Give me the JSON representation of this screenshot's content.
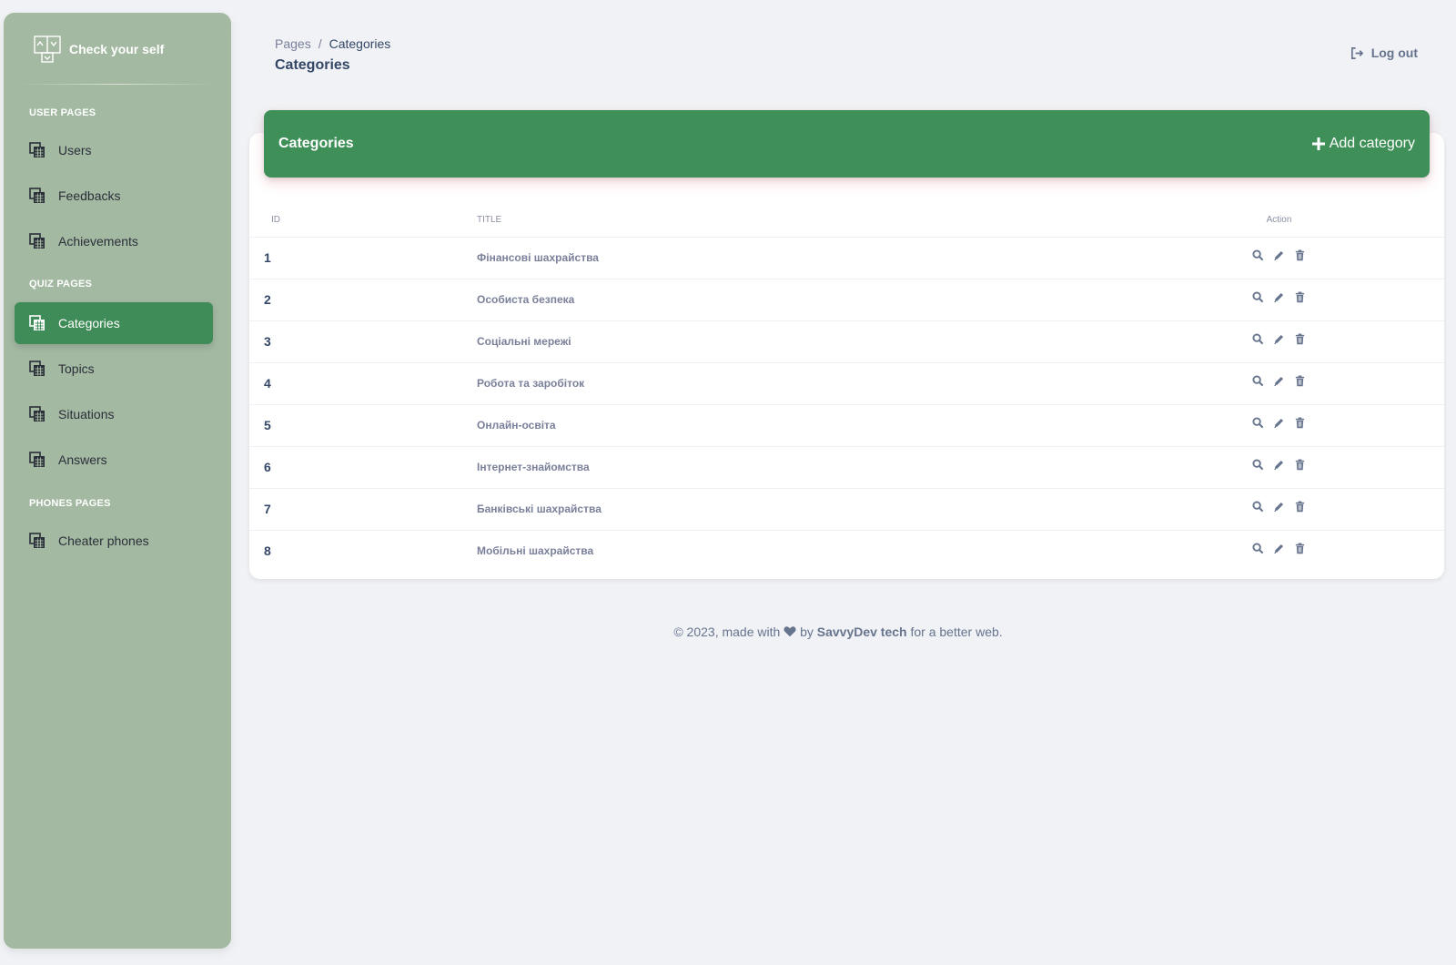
{
  "sidebar": {
    "brand": "Check your self",
    "sections": [
      {
        "title": "USER PAGES"
      },
      {
        "title": "QUIZ PAGES"
      },
      {
        "title": "PHONES PAGES"
      }
    ],
    "items": [
      {
        "label": "Users"
      },
      {
        "label": "Feedbacks"
      },
      {
        "label": "Achievements"
      },
      {
        "label": "Categories",
        "active": true
      },
      {
        "label": "Topics"
      },
      {
        "label": "Situations"
      },
      {
        "label": "Answers"
      },
      {
        "label": "Cheater phones"
      }
    ]
  },
  "header": {
    "breadcrumb": {
      "root": "Pages",
      "separator": "/",
      "current": "Categories"
    },
    "title": "Categories",
    "logout": "Log out"
  },
  "card": {
    "title": "Categories",
    "add_label": "Add category",
    "columns": [
      "ID",
      "TITLE",
      "Action"
    ],
    "rows": [
      {
        "id": "1",
        "title": "Фінансові шахрайства"
      },
      {
        "id": "2",
        "title": "Особиста безпека"
      },
      {
        "id": "3",
        "title": "Соціальні мережі"
      },
      {
        "id": "4",
        "title": "Робота та заробіток"
      },
      {
        "id": "5",
        "title": "Онлайн-освіта"
      },
      {
        "id": "6",
        "title": "Інтернет-знайомства"
      },
      {
        "id": "7",
        "title": "Банківські шахрайства"
      },
      {
        "id": "8",
        "title": "Мобільні шахрайства"
      }
    ]
  },
  "footer": {
    "prefix": "© 2023, made with",
    "by": "by",
    "author": "SavvyDev tech",
    "suffix": "for a better web."
  },
  "colors": {
    "sidebar_bg": "#a3b9a2",
    "accent": "#3f8f58",
    "page_bg": "#f0f2f5"
  }
}
